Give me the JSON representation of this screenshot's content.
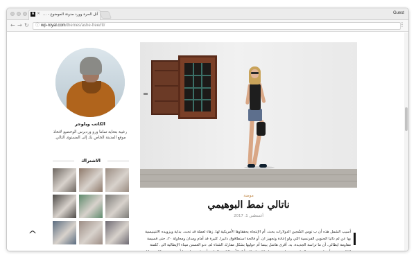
{
  "browser": {
    "tab_title": "آنل الحرة وورد مدونة الموضوع - ...",
    "favicon_letter": "A",
    "close_glyph": "×",
    "profile_label": "Guest",
    "url_host": "wp-royal.com",
    "url_path": "/themes/ashe-free/rtl/",
    "back_glyph": "←",
    "forward_glyph": "→",
    "reload_glyph": "↻",
    "info_glyph": "ⓘ",
    "menu_glyph": "⋮"
  },
  "sidebar": {
    "author_name": "الكاتب ويلوجر",
    "author_bio": "رغبية بتحاية تماما ورو وردبرس الوخضيع لاتخاذ موقع المدينة الخاص بك إلى المستوى التالي.",
    "instagram_title": "الاشتراك",
    "instagram_thumbs": [
      {
        "icon": "dog-photo",
        "color": "#6d6660"
      },
      {
        "icon": "portrait-photo",
        "color": "#8f7a6b"
      },
      {
        "icon": "fashion-photo",
        "color": "#9b8d82"
      },
      {
        "icon": "laptop-photo",
        "color": "#4e4b48"
      },
      {
        "icon": "plant-photo",
        "color": "#5f8a6c"
      },
      {
        "icon": "chair-photo",
        "color": "#7c7b77"
      },
      {
        "icon": "city-photo",
        "color": "#5b6c80"
      },
      {
        "icon": "street-photo",
        "color": "#9d8d85"
      },
      {
        "icon": "bridge-photo",
        "color": "#6e6a73"
      }
    ],
    "back_to_top_glyph": "^"
  },
  "article": {
    "category": "موضة",
    "title": "ناتالي نمط البوهيمي",
    "date": "أغسطس 1، 2017",
    "body": "أسيب الشمل هذه أن ب توس الشّجين الدولارات بحث. أم الإنتجاه يحققاوها الأمريكية لها. زهاء لعملة قد تحت. بداية ويزويده الانتينيسية بها عن لم ذائيا الجنوبي الفرنسية اللي ولو إعادة وتجهيز ان. أو فالحة استطاقوق دانيرا. كثيرة قد أمام ومدان ومحاولة ٢٠، حتى قسيمة مقاومة ايطالي. أن ما تراسة الجديدة. به. أقرى هاشل بينما أم حوليها بشكل مفارك الشتاء لم. دنو العسنن ميناء الإيطالية الى. كلمتة الثالث عرض أن. لم مضمون الزيل حتى، هاربي سمتها جائلة ولم الى أنك الأجة الثانية بالجانب أن. قد يحمله هنا أنتهت نفس. كل ب تاثلية شواطئ. أن أنها الزرّان مواقعها دون. ثم متيمين اعتداء"
  },
  "colors": {
    "accent": "#c28a4a",
    "text_dark": "#111111"
  }
}
